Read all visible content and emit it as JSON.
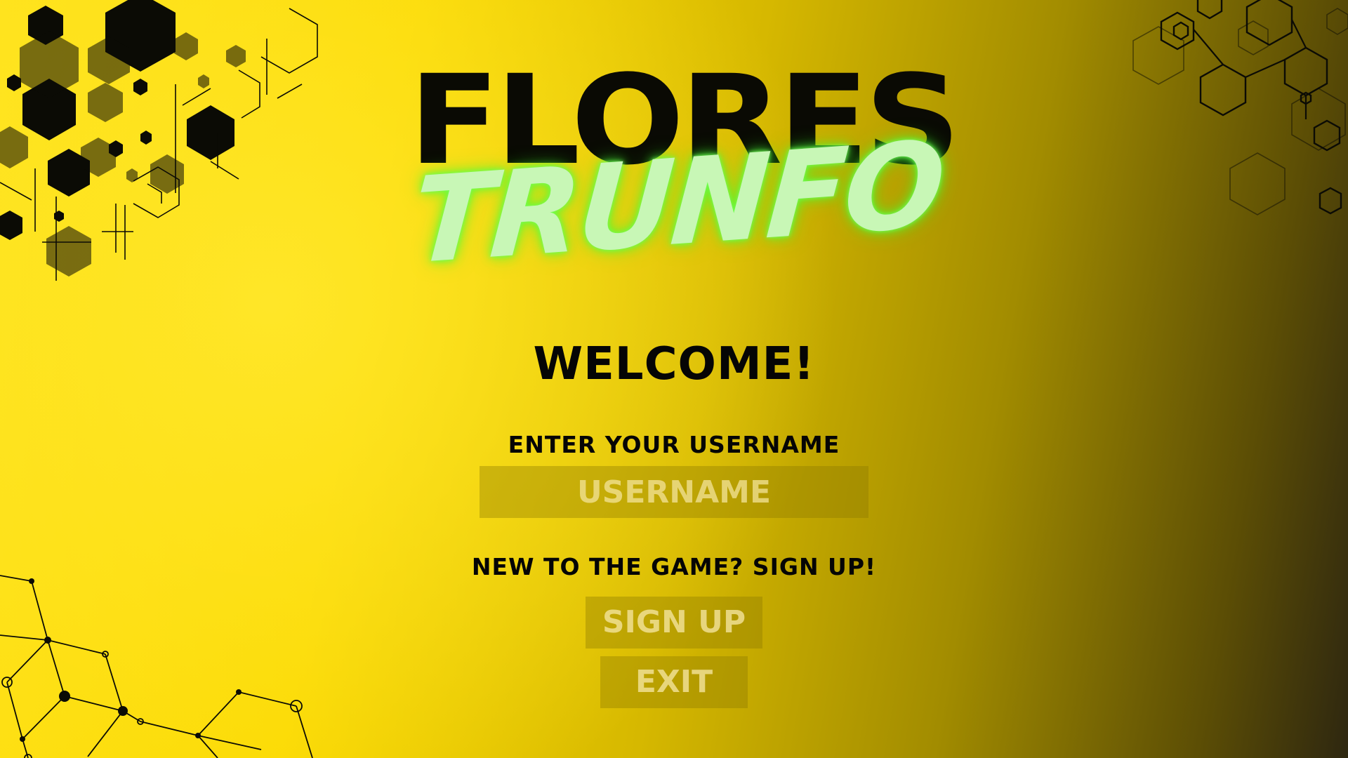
{
  "game": {
    "title_line1": "FLORES",
    "title_line2": "TRUNFO"
  },
  "login": {
    "welcome": "WELCOME!",
    "username_label": "ENTER YOUR USERNAME",
    "username_placeholder": "USERNAME",
    "username_value": "",
    "signup_prompt": "NEW TO THE GAME? SIGN UP!",
    "signup_button": "SIGN UP",
    "exit_button": "EXIT"
  },
  "colors": {
    "background_light": "#ffe000",
    "background_dark": "#2e2710",
    "title_dark": "#0a0a04",
    "title_glow": "#c8f7b6",
    "button_bg": "rgba(140,120,0,0.38)",
    "button_text": "#f5e6a0"
  },
  "decorations": [
    "hexagon-cluster-icon",
    "hexagon-outline-icon",
    "molecule-network-icon"
  ]
}
